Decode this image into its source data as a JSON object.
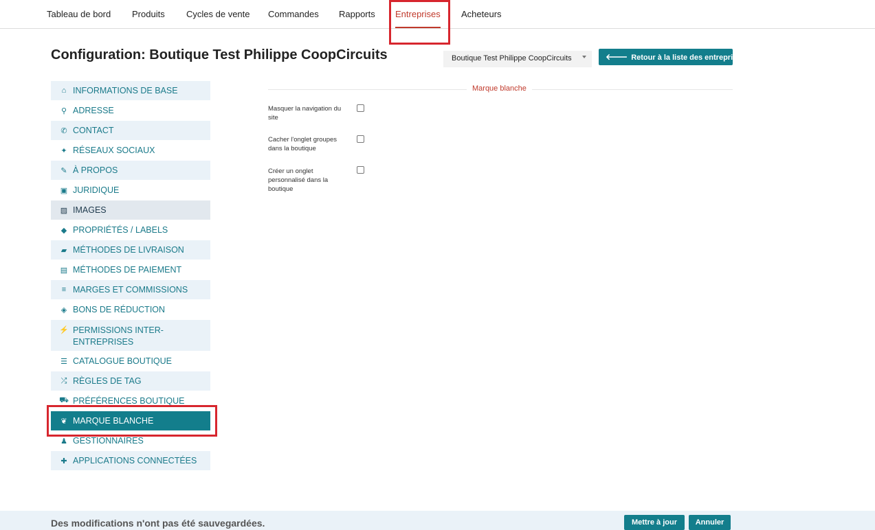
{
  "topnav": {
    "items": [
      {
        "label": "Tableau de bord"
      },
      {
        "label": "Produits"
      },
      {
        "label": "Cycles de vente"
      },
      {
        "label": "Commandes"
      },
      {
        "label": "Rapports"
      },
      {
        "label": "Entreprises"
      },
      {
        "label": "Acheteurs"
      }
    ],
    "active": "Entreprises",
    "active_color": "#c0392b"
  },
  "header": {
    "title": "Configuration: Boutique Test Philippe CoopCircuits",
    "enterprise_select_value": "Boutique Test Philippe CoopCircuits",
    "back_button_label": "Retour à la liste des entreprises"
  },
  "sidebar": {
    "items": [
      {
        "label": "INFORMATIONS DE BASE",
        "icon": "home-icon",
        "glyph": "⌂"
      },
      {
        "label": "ADRESSE",
        "icon": "map-marker-icon",
        "glyph": "⚲"
      },
      {
        "label": "CONTACT",
        "icon": "phone-icon",
        "glyph": "✆"
      },
      {
        "label": "RÉSEAUX SOCIAUX",
        "icon": "twitter-icon",
        "glyph": "✦"
      },
      {
        "label": "À PROPOS",
        "icon": "pencil-icon",
        "glyph": "✎"
      },
      {
        "label": "JURIDIQUE",
        "icon": "briefcase-icon",
        "glyph": "▣"
      },
      {
        "label": "IMAGES",
        "icon": "image-icon",
        "glyph": "▨"
      },
      {
        "label": "PROPRIÉTÉS / LABELS",
        "icon": "tags-icon",
        "glyph": "◆"
      },
      {
        "label": "MÉTHODES DE LIVRAISON",
        "icon": "truck-icon",
        "glyph": "▰"
      },
      {
        "label": "MÉTHODES DE PAIEMENT",
        "icon": "money-icon",
        "glyph": "▤"
      },
      {
        "label": "MARGES ET COMMISSIONS",
        "icon": "tasks-icon",
        "glyph": "≡"
      },
      {
        "label": "BONS DE RÉDUCTION",
        "icon": "ticket-icon",
        "glyph": "◈"
      },
      {
        "label": "PERMISSIONS INTER-ENTREPRISES",
        "icon": "plug-icon",
        "glyph": "⚡"
      },
      {
        "label": "CATALOGUE BOUTIQUE",
        "icon": "list-icon",
        "glyph": "☰"
      },
      {
        "label": "RÈGLES DE TAG",
        "icon": "random-icon",
        "glyph": "⤮"
      },
      {
        "label": "PRÉFÉRENCES BOUTIQUE",
        "icon": "cart-icon",
        "glyph": "⛟"
      },
      {
        "label": "MARQUE BLANCHE",
        "icon": "leaf-icon",
        "glyph": "❦"
      },
      {
        "label": "GESTIONNAIRES",
        "icon": "user-icon",
        "glyph": "♟"
      },
      {
        "label": "APPLICATIONS CONNECTÉES",
        "icon": "puzzle-icon",
        "glyph": "✚"
      }
    ],
    "active": "MARQUE BLANCHE",
    "active_color": "#137e8c"
  },
  "form": {
    "section_title": "Marque blanche",
    "fields": [
      {
        "label": "Masquer la navigation du site",
        "checked": false
      },
      {
        "label": "Cacher l'onglet groupes dans la boutique",
        "checked": false
      },
      {
        "label": "Créer un onglet personnalisé dans la boutique",
        "checked": false
      }
    ]
  },
  "footer": {
    "unsaved_message": "Des modifications n'ont pas été sauvegardées.",
    "update_button": "Mettre à jour",
    "cancel_button": "Annuler"
  },
  "colors": {
    "accent": "#137e8c",
    "highlight_red": "#d7262e",
    "sidebar_bg": "#eaf2f8"
  }
}
